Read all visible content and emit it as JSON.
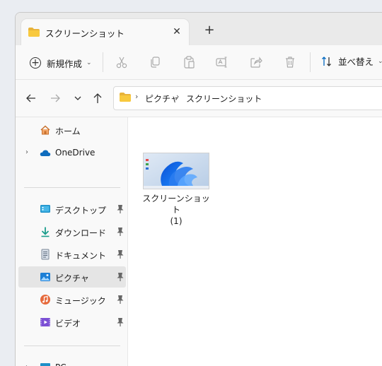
{
  "tab": {
    "title": "スクリーンショット",
    "close_symbol": "✕",
    "new_tab_symbol": "+"
  },
  "toolbar": {
    "new_label": "新規作成",
    "new_chevron": "⌄",
    "sort_label": "並べ替え",
    "sort_chevron": "⌄",
    "icons": [
      "cut-icon",
      "copy-icon",
      "paste-icon",
      "rename-icon",
      "share-icon",
      "delete-icon"
    ]
  },
  "address": {
    "crumbs": [
      "ピクチャ",
      "スクリーンショット"
    ],
    "separator": "›"
  },
  "sidebar": {
    "home": "ホーム",
    "onedrive": "OneDrive",
    "quick": [
      {
        "label": "デスクトップ",
        "icon": "desktop-icon"
      },
      {
        "label": "ダウンロード",
        "icon": "download-icon"
      },
      {
        "label": "ドキュメント",
        "icon": "documents-icon"
      },
      {
        "label": "ピクチャ",
        "icon": "pictures-icon",
        "selected": true
      },
      {
        "label": "ミュージック",
        "icon": "music-icon"
      },
      {
        "label": "ビデオ",
        "icon": "videos-icon"
      }
    ],
    "pc": "PC"
  },
  "content": {
    "files": [
      {
        "line1": "スクリーンショット",
        "line2": "(1)"
      }
    ]
  },
  "colors": {
    "accent": "#0067c0",
    "folder": "#f8c93e",
    "selection": "#e5e5e5"
  }
}
